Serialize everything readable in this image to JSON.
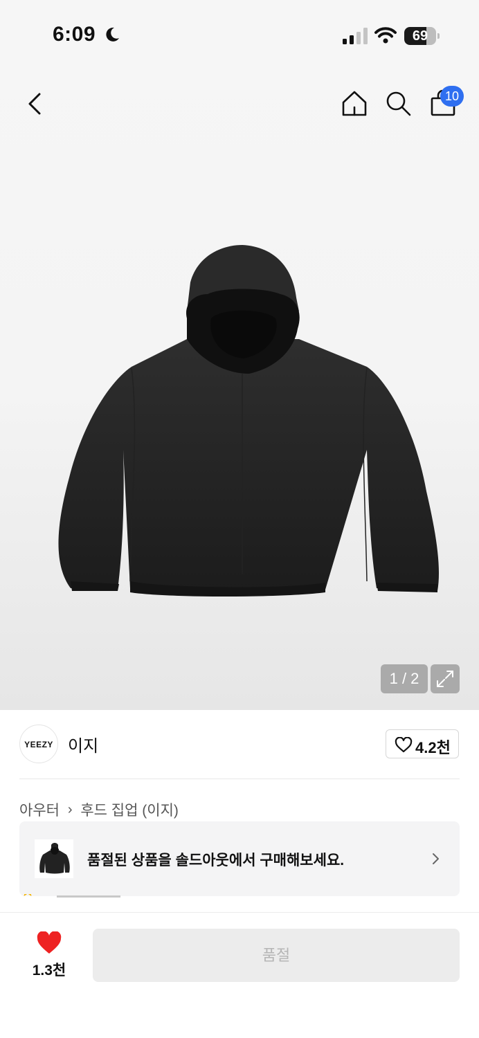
{
  "status_bar": {
    "time": "6:09",
    "battery": "69",
    "battery_level": 0.69
  },
  "header": {
    "cart_badge": "10",
    "icons": [
      "back-icon",
      "home-icon",
      "search-icon",
      "bag-icon"
    ]
  },
  "gallery": {
    "counter": "1 / 2"
  },
  "brand": {
    "logo_text": "YEEZY",
    "name": "이지",
    "likes": "4.2천"
  },
  "breadcrumb": {
    "category": "아우터",
    "subcategory": "후드 집업 (이지)"
  },
  "banner": {
    "text": "품절된 상품을 솔드아웃에서 구매해보세요."
  },
  "bottom": {
    "wish_count": "1.3천",
    "soldout_label": "품절"
  },
  "colors": {
    "accent": "#2f6ff0",
    "heart": "#ee2222"
  }
}
